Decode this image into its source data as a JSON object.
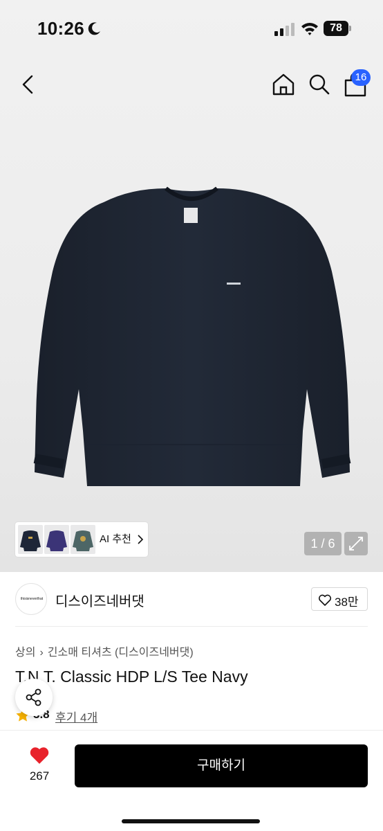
{
  "status_bar": {
    "time": "10:26",
    "battery": "78"
  },
  "header": {
    "cart_count": "16"
  },
  "gallery": {
    "ai_recommend_label": "AI 추천",
    "counter": "1 / 6"
  },
  "brand": {
    "logo_text": "thisisneverthat",
    "name": "디스이즈네버댓",
    "likes": "38만"
  },
  "product": {
    "breadcrumb": [
      "상의",
      "긴소매 티셔츠 (디스이즈네버댓)"
    ],
    "title": "T.N.T. Classic HDP L/S Tee Navy",
    "rating": "3.8",
    "reviews": "후기 4개"
  },
  "bottom_bar": {
    "wish_count": "267",
    "buy_label": "구매하기"
  },
  "colors": {
    "accent_badge": "#2962ff",
    "heart": "#e8222b",
    "star": "#f6b100",
    "buy_button": "#000000",
    "garment": "#1d2431"
  }
}
